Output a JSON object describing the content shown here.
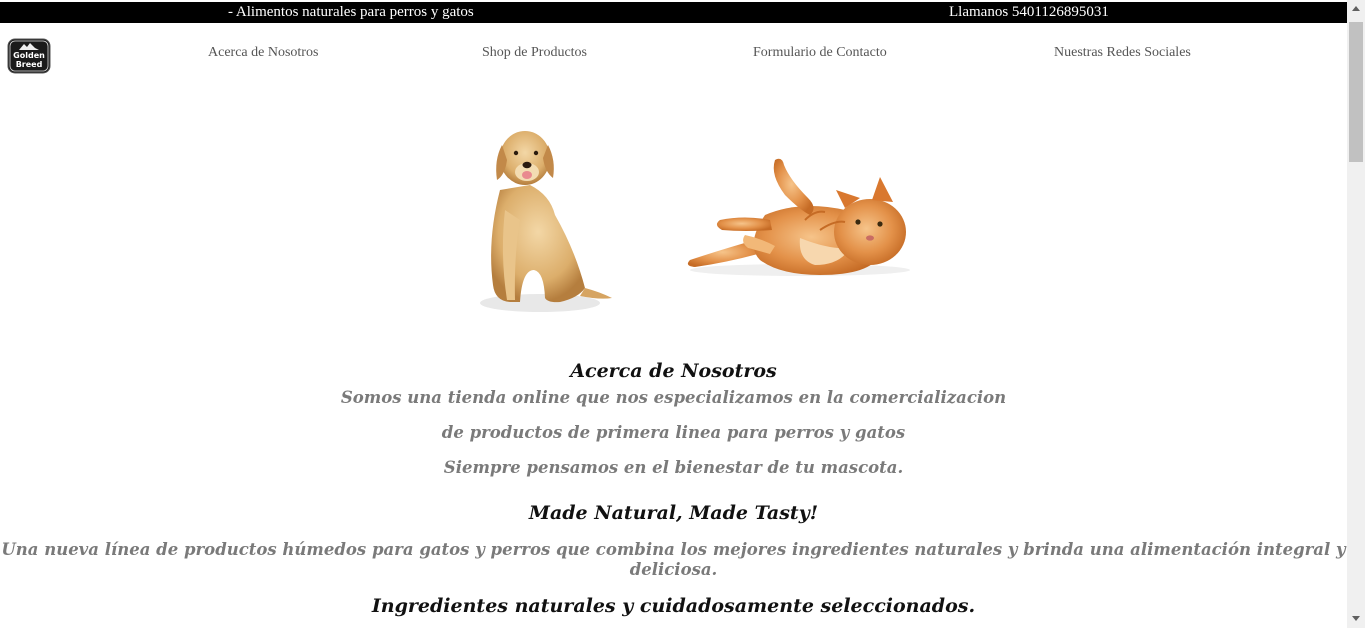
{
  "topbar": {
    "tagline": "- Alimentos naturales para perros y gatos",
    "phone": "Llamanos 5401126895031"
  },
  "logo": {
    "line1": "Golden",
    "line2": "Breed",
    "icon": "golden-breed-logo-icon"
  },
  "nav": {
    "items": [
      "Acerca de Nosotros",
      "Shop de Productos",
      "Formulario de Contacto",
      "Nuestras Redes Sociales"
    ]
  },
  "hero": {
    "images": [
      "golden-retriever-dog-image",
      "orange-cat-lying-image"
    ]
  },
  "about": {
    "heading": "Acerca de Nosotros",
    "lines": [
      "Somos una tienda online que nos especializamos en la comercializacion",
      "de productos de primera linea para perros y gatos",
      "Siempre pensamos en el bienestar de tu mascota."
    ]
  },
  "natural": {
    "heading": "Made Natural, Made Tasty!",
    "text_line1": "Una nueva línea de productos húmedos para gatos y perros que combina los mejores ingredientes naturales y brinda una alimentación integral y",
    "text_line2": "deliciosa."
  },
  "ingredients": {
    "heading": "Ingredientes naturales y cuidadosamente seleccionados."
  },
  "colors": {
    "topbar_bg": "#000000",
    "nav_text": "#555555",
    "body_text": "#7a7a7a",
    "heading": "#111111"
  }
}
